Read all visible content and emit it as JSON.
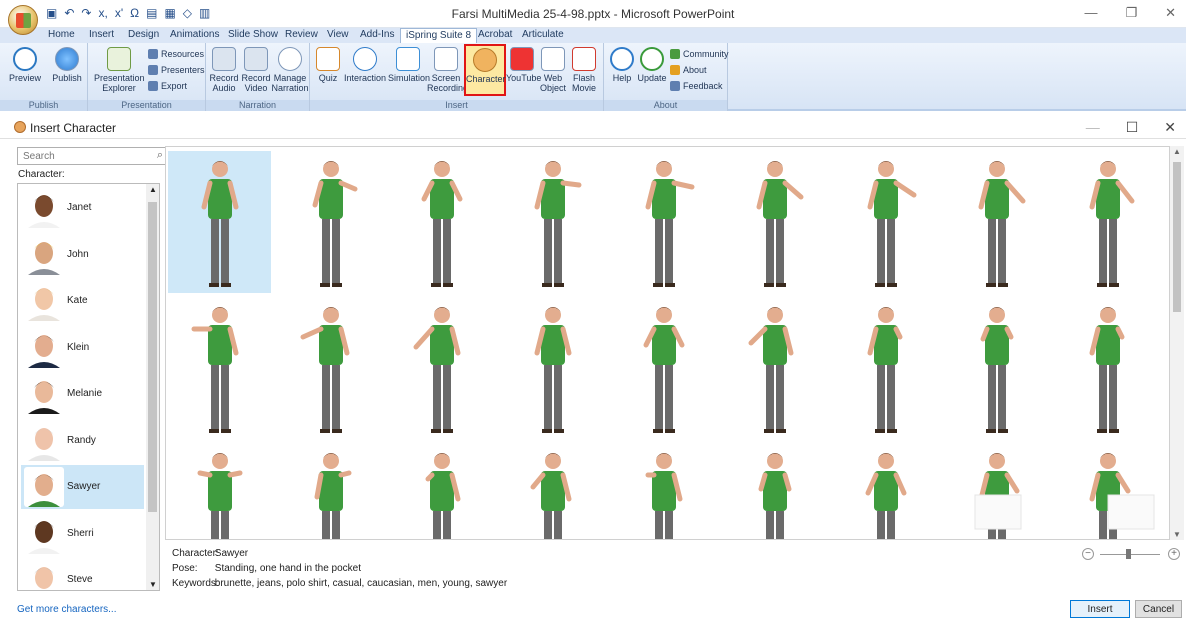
{
  "window": {
    "title": "Farsi MultiMedia 25-4-98.pptx - Microsoft PowerPoint",
    "qat": [
      "▣",
      "↶",
      "↷",
      "x,",
      "x'",
      "Ω",
      "▤",
      "▦",
      "◇",
      "▥"
    ]
  },
  "ribbon_tabs": [
    "Home",
    "Insert",
    "Design",
    "Animations",
    "Slide Show",
    "Review",
    "View",
    "Add-Ins",
    "iSpring Suite 8",
    "Acrobat",
    "Articulate"
  ],
  "active_tab": "iSpring Suite 8",
  "ribbon": {
    "publish": {
      "name": "Publish",
      "preview": "Preview",
      "publish": "Publish"
    },
    "presentation": {
      "name": "Presentation",
      "explorer_1": "Presentation",
      "explorer_2": "Explorer",
      "resources": "Resources",
      "presenters": "Presenters",
      "export": "Export"
    },
    "narration": {
      "name": "Narration",
      "record_audio_1": "Record",
      "record_audio_2": "Audio",
      "record_video_1": "Record",
      "record_video_2": "Video",
      "manage_1": "Manage",
      "manage_2": "Narration"
    },
    "insert": {
      "name": "Insert",
      "quiz": "Quiz",
      "interaction": "Interaction",
      "simulation": "Simulation",
      "screen_1": "Screen",
      "screen_2": "Recording",
      "character": "Character",
      "youtube": "YouTube",
      "web_1": "Web",
      "web_2": "Object",
      "flash_1": "Flash",
      "flash_2": "Movie"
    },
    "about": {
      "name": "About",
      "help": "Help",
      "update": "Update",
      "community": "Community",
      "about": "About",
      "feedback": "Feedback"
    }
  },
  "dialog": {
    "title": "Insert Character",
    "search_placeholder": "Search",
    "character_label": "Character:",
    "characters": [
      {
        "name": "Janet",
        "skin": "#7a4a2e",
        "hair": "#1c120c",
        "shirt": "#f2f2f2",
        "selected": false
      },
      {
        "name": "John",
        "skin": "#d9a57f",
        "hair": "#e6b81e",
        "shirt": "#8a8f98",
        "selected": false
      },
      {
        "name": "Kate",
        "skin": "#f1c7a7",
        "hair": "#d9b56a",
        "shirt": "#e9e4dd",
        "selected": false
      },
      {
        "name": "Klein",
        "skin": "#e3ad8f",
        "hair": "#3b2b20",
        "shirt": "#1d2a44",
        "selected": false
      },
      {
        "name": "Melanie",
        "skin": "#e9b99a",
        "hair": "#120b07",
        "shirt": "#1a1a1a",
        "selected": false
      },
      {
        "name": "Randy",
        "skin": "#efc3aa",
        "hair": "#c9c9c9",
        "shirt": "#e7e7e7",
        "selected": false
      },
      {
        "name": "Sawyer",
        "skin": "#e2ae8d",
        "hair": "#4a3222",
        "shirt": "#3c8f3c",
        "selected": true
      },
      {
        "name": "Sherri",
        "skin": "#5e3821",
        "hair": "#1a0f08",
        "shirt": "#f2f2f2",
        "selected": false
      },
      {
        "name": "Steve",
        "skin": "#f0c4a8",
        "hair": "#aaaaaa",
        "shirt": "#d8dde6",
        "selected": false
      }
    ],
    "info": {
      "character_key": "Character:",
      "character_val": "Sawyer",
      "pose_key": "Pose:",
      "pose_val": "Standing, one hand in the pocket",
      "keywords_key": "Keywords:",
      "keywords_val": "brunette, jeans, polo shirt, casual, caucasian, men, young, sawyer"
    },
    "get_more": "Get more characters...",
    "insert_button": "Insert",
    "cancel_button": "Cancel",
    "zoom_minus": "−",
    "zoom_plus": "+"
  },
  "colors": {
    "accent": "#0078d7",
    "selection": "#cfe8f8",
    "shirt": "#3e9b3e",
    "jeans": "#6a6a6a",
    "highlight": "#e01515"
  }
}
